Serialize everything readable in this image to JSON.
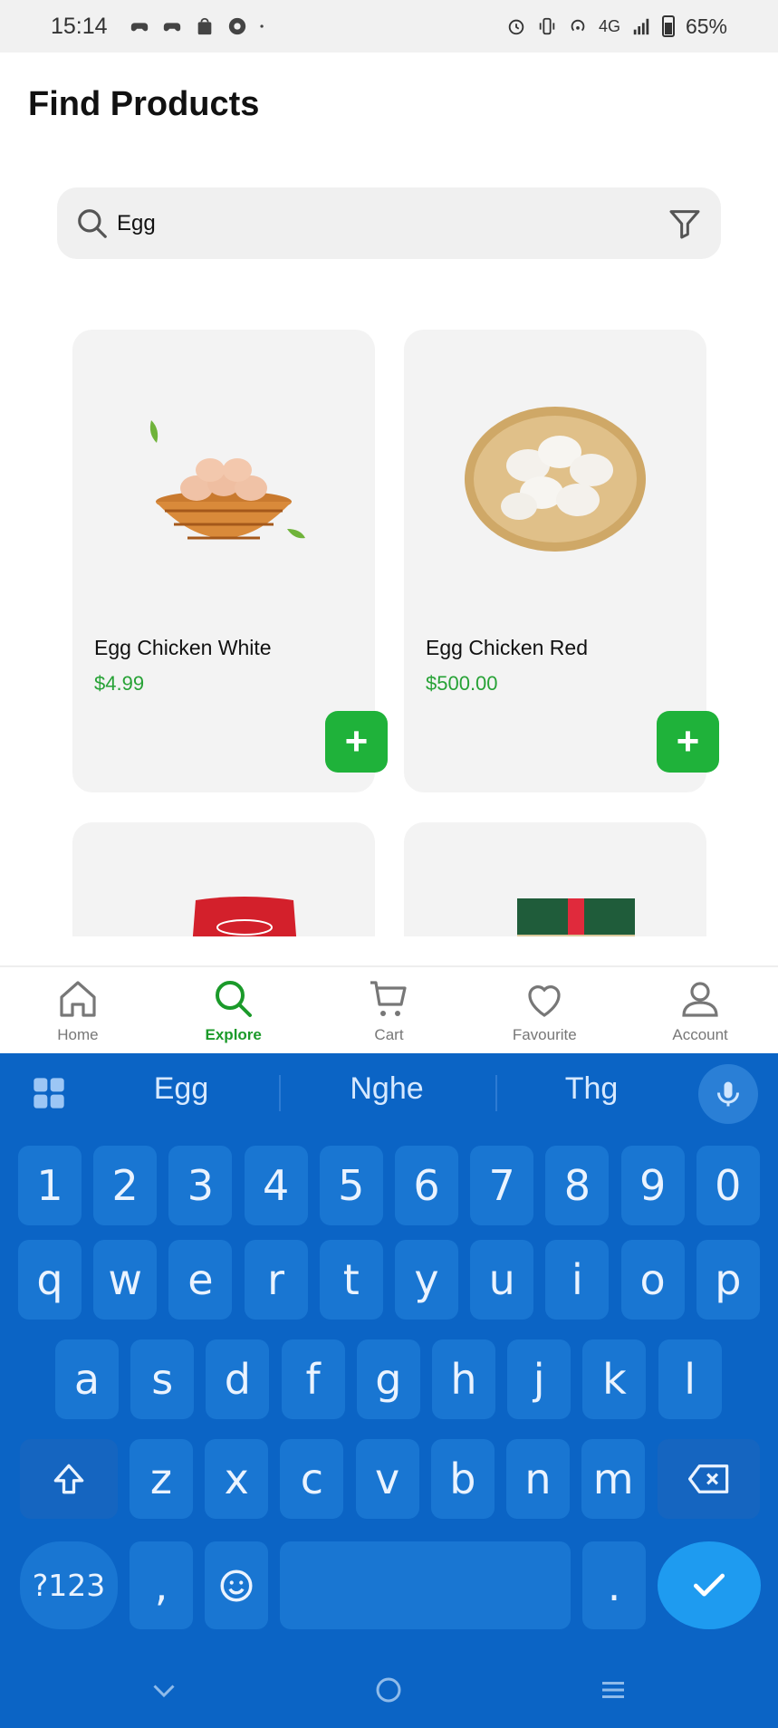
{
  "status_bar": {
    "time": "15:14",
    "network": "4G",
    "battery": "65%"
  },
  "header": {
    "title": "Find Products"
  },
  "search": {
    "value": "Egg"
  },
  "products": [
    {
      "name": "Egg Chicken White",
      "price": "$4.99"
    },
    {
      "name": "Egg Chicken Red",
      "price": "$500.00"
    }
  ],
  "bottom_nav": [
    {
      "label": "Home",
      "icon": "home-icon",
      "active": false
    },
    {
      "label": "Explore",
      "icon": "search-icon",
      "active": true
    },
    {
      "label": "Cart",
      "icon": "cart-icon",
      "active": false
    },
    {
      "label": "Favourite",
      "icon": "heart-icon",
      "active": false
    },
    {
      "label": "Account",
      "icon": "user-icon",
      "active": false
    }
  ],
  "keyboard": {
    "suggestions": [
      "Egg",
      "Nghe",
      "Thg"
    ],
    "row_numbers": [
      "1",
      "2",
      "3",
      "4",
      "5",
      "6",
      "7",
      "8",
      "9",
      "0"
    ],
    "row_top": [
      "q",
      "w",
      "e",
      "r",
      "t",
      "y",
      "u",
      "i",
      "o",
      "p"
    ],
    "row_mid": [
      "a",
      "s",
      "d",
      "f",
      "g",
      "h",
      "j",
      "k",
      "l"
    ],
    "row_bottom": [
      "z",
      "x",
      "c",
      "v",
      "b",
      "n",
      "m"
    ],
    "symbols_label": "?123",
    "comma": ",",
    "period": "."
  },
  "colors": {
    "accent": "#1fb23a",
    "keyboard_bg": "#0b64c5"
  }
}
